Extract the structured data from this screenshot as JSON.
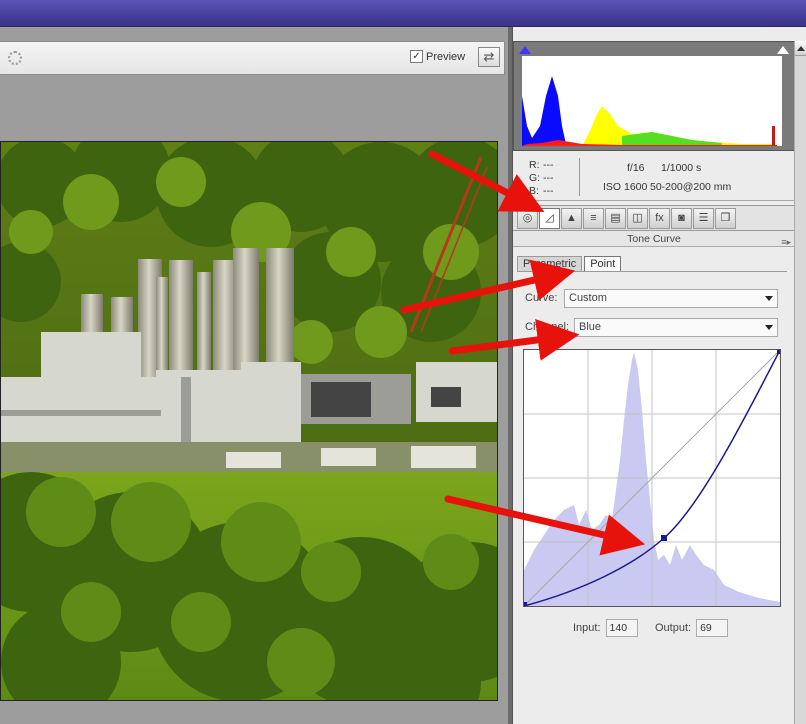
{
  "toolbar": {
    "preview_label": "Preview",
    "preview_checked": true,
    "preview_check_glyph": "✓",
    "toggle_glyph": "⇄"
  },
  "histogram": {
    "r_label": "R:",
    "g_label": "G:",
    "b_label": "B:",
    "r_value": "---",
    "g_value": "---",
    "b_value": "---",
    "aperture": "f/16",
    "shutter": "1/1000 s",
    "iso": "ISO 1600",
    "lens": "50-200@200 mm"
  },
  "tab_icons": [
    {
      "name": "basic-tab-icon",
      "glyph": "◎"
    },
    {
      "name": "tone-curve-tab-icon",
      "glyph": "◿"
    },
    {
      "name": "detail-tab-icon",
      "glyph": "▲"
    },
    {
      "name": "hsl-tab-icon",
      "glyph": "≡"
    },
    {
      "name": "split-toning-tab-icon",
      "glyph": "▤"
    },
    {
      "name": "lens-corrections-tab-icon",
      "glyph": "◫"
    },
    {
      "name": "effects-tab-icon",
      "glyph": "fx"
    },
    {
      "name": "camera-calibration-tab-icon",
      "glyph": "◙"
    },
    {
      "name": "presets-tab-icon",
      "glyph": "☰"
    },
    {
      "name": "snapshots-tab-icon",
      "glyph": "❐"
    }
  ],
  "panel": {
    "title": "Tone Curve",
    "menu_glyph": "≡▸",
    "tabs": [
      "Parametric",
      "Point"
    ],
    "active_tab": "Point",
    "curve_label": "Curve:",
    "curve_value": "Custom",
    "channel_label": "Channel:",
    "channel_value": "Blue",
    "input_label": "Input:",
    "input_value": "140",
    "output_label": "Output:",
    "output_value": "69"
  },
  "colors": {
    "annotation_arrow": "#e8120c",
    "curve_line": "#1a1a8c",
    "histogram_fill": "#c9c9f2"
  }
}
